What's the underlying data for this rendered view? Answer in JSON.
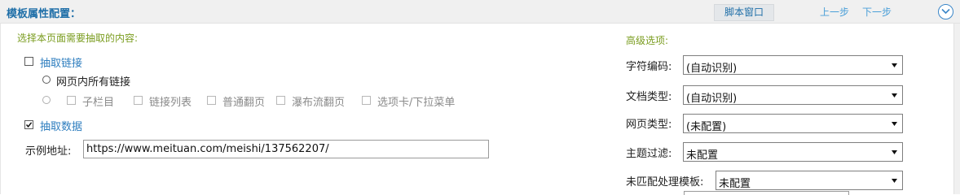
{
  "header": {
    "title": "模板属性配置：",
    "script_window_button": "脚本窗口",
    "prev_label": "上一步",
    "next_label": "下一步"
  },
  "extract": {
    "section_title": "选择本页面需要抽取的内容:",
    "links_label": "抽取链接",
    "links_checked": false,
    "all_links_label": "网页内所有链接",
    "other_options": [
      "子栏目",
      "链接列表",
      "普通翻页",
      "瀑布流翻页",
      "选项卡/下拉菜单"
    ],
    "data_label": "抽取数据",
    "data_checked": true,
    "example_label": "示例地址:",
    "example_url": "https://www.meituan.com/meishi/137562207/"
  },
  "advanced": {
    "section_title": "高级选项:",
    "charset_label": "字符编码:",
    "charset_value": "(自动识别)",
    "doctype_label": "文档类型:",
    "doctype_value": "(自动识别)",
    "pagetype_label": "网页类型:",
    "pagetype_value": "(未配置)",
    "filter_label": "主题过滤:",
    "filter_value": "未配置",
    "unmatched_label": "未匹配处理模板:",
    "unmatched_value": "未配置"
  },
  "colors": {
    "title_blue": "#1f6fa8",
    "link_blue": "#2e7ebf",
    "section_green": "#7a9c1f",
    "header_bg": "#f0f0f0"
  }
}
